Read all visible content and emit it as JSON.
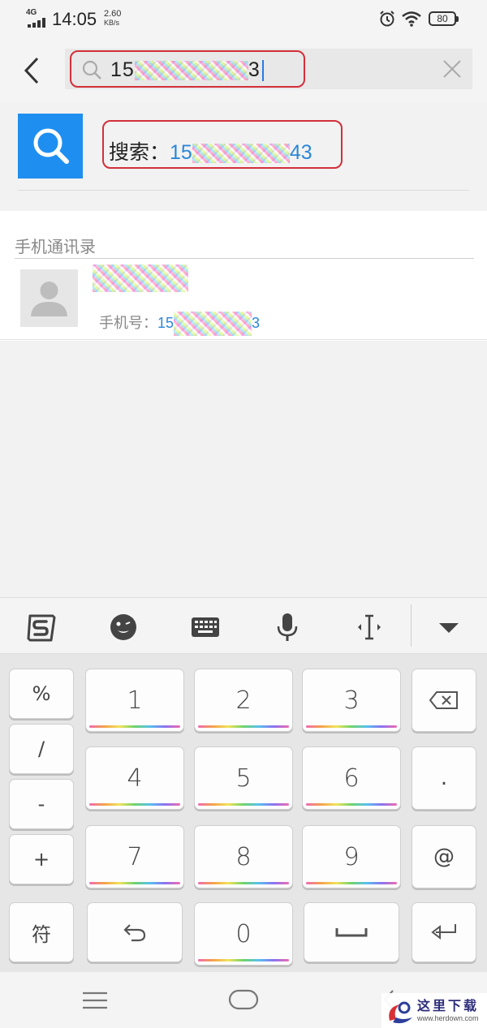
{
  "status_bar": {
    "network": "4G",
    "time": "14:05",
    "speed_value": "2.60",
    "speed_unit": "KB/s",
    "battery": "80"
  },
  "search": {
    "query_visible_prefix": "15",
    "query_visible_suffix": "3"
  },
  "suggestion": {
    "label": "搜索：",
    "num_prefix": "15",
    "num_suffix": "43"
  },
  "contacts": {
    "section_title": "手机通讯录",
    "items": [
      {
        "phone_label": "手机号：",
        "phone_prefix": "15",
        "phone_suffix": "3"
      }
    ]
  },
  "keyboard": {
    "toolbar_icons": [
      "sogou-logo-icon",
      "emoji-icon",
      "keyboard-icon",
      "microphone-icon",
      "cursor-move-icon",
      "collapse-icon"
    ],
    "left_column": [
      "%",
      "/",
      "-",
      "+"
    ],
    "digits": [
      "1",
      "2",
      "3",
      "4",
      "5",
      "6",
      "7",
      "8",
      "9",
      "0"
    ],
    "right_column": [
      ".",
      "@"
    ],
    "symbol_key": "符"
  },
  "watermark": {
    "text": "这里下载",
    "url": "www.herdown.com"
  },
  "colors": {
    "accent_blue": "#1e8ff0",
    "link_blue": "#2a87d8",
    "highlight_red": "#d32f3a"
  }
}
